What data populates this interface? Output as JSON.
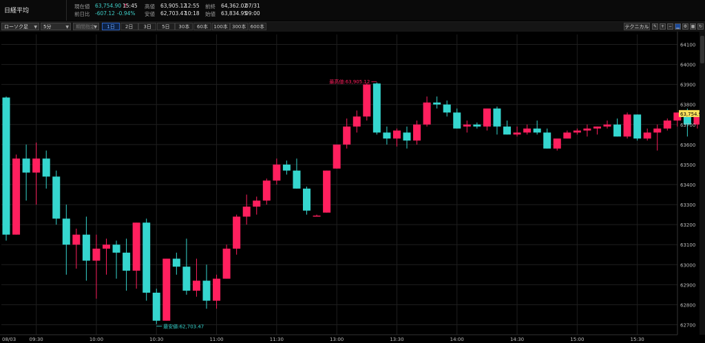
{
  "header": {
    "name": "日経平均",
    "rows": [
      [
        {
          "label": "現在値",
          "value": "63,754.90",
          "cls": "up",
          "extra": "↑",
          "time": "15:45"
        },
        {
          "label": "高値",
          "value": "63,905.12",
          "time": "12:55"
        },
        {
          "label": "前終",
          "value": "64,362.02",
          "time": "07/31"
        }
      ],
      [
        {
          "label": "前日比",
          "value": "-607.12",
          "cls": "up",
          "extra": "-0.94%",
          "time": ""
        },
        {
          "label": "安値",
          "value": "62,703.47",
          "time": "10:18"
        },
        {
          "label": "始値",
          "value": "63,834.95",
          "time": "09:00"
        }
      ]
    ]
  },
  "toolbar": {
    "chart_type": "ローソク足",
    "interval": "5分",
    "period_select": "期間指定",
    "periods": [
      "1日",
      "2日",
      "3日",
      "5日",
      "30本",
      "60本",
      "100本",
      "300本",
      "600本"
    ],
    "active_period": "1日",
    "technical": "テクニカル"
  },
  "colors": {
    "up": "#ff1f5e",
    "down": "#35d6cf",
    "bg": "#000000",
    "grid": "#1f1f1f",
    "price_tag": "#ffe45c"
  },
  "chart_data": {
    "type": "candlestick",
    "date_label": "08/03",
    "x_tick_labels": [
      {
        "i": 3,
        "label": "09:30"
      },
      {
        "i": 9,
        "label": "10:00"
      },
      {
        "i": 15,
        "label": "10:30"
      },
      {
        "i": 21,
        "label": "11:00"
      },
      {
        "i": 27,
        "label": "11:30"
      },
      {
        "i": 33,
        "label": "13:00"
      },
      {
        "i": 39,
        "label": "13:30"
      },
      {
        "i": 45,
        "label": "14:00"
      },
      {
        "i": 51,
        "label": "14:30"
      },
      {
        "i": 57,
        "label": "15:00"
      },
      {
        "i": 63,
        "label": "15:30"
      }
    ],
    "ylim": [
      62650,
      64150
    ],
    "y_ticks": [
      62700,
      62800,
      62900,
      63000,
      63100,
      63200,
      63300,
      63400,
      63500,
      63600,
      63700,
      63800,
      63900,
      64000,
      64100
    ],
    "current_price": 63754.9,
    "current_label": "63,754.90",
    "high_annotation": "最高値:63,905.12",
    "low_annotation": "最安値:62,703.47",
    "candles": [
      [
        63835,
        63840,
        63120,
        63150
      ],
      [
        63150,
        63550,
        63150,
        63530
      ],
      [
        63530,
        63600,
        63320,
        63460
      ],
      [
        63460,
        63610,
        63300,
        63530
      ],
      [
        63530,
        63570,
        63380,
        63440
      ],
      [
        63440,
        63470,
        63200,
        63230
      ],
      [
        63230,
        63300,
        62950,
        63100
      ],
      [
        63100,
        63180,
        62980,
        63150
      ],
      [
        63150,
        63240,
        62920,
        63020
      ],
      [
        63020,
        63150,
        62830,
        63080
      ],
      [
        63080,
        63130,
        62950,
        63100
      ],
      [
        63100,
        63120,
        62930,
        63060
      ],
      [
        63060,
        63130,
        62870,
        62970
      ],
      [
        62970,
        63210,
        62880,
        63210
      ],
      [
        63210,
        63230,
        62820,
        62860
      ],
      [
        62860,
        62880,
        62703,
        62720
      ],
      [
        62720,
        63030,
        62720,
        63030
      ],
      [
        63030,
        63060,
        62950,
        62990
      ],
      [
        62990,
        63130,
        62850,
        62870
      ],
      [
        62870,
        63030,
        62840,
        62920
      ],
      [
        62920,
        63000,
        62780,
        62820
      ],
      [
        62820,
        62950,
        62780,
        62930
      ],
      [
        62930,
        63100,
        62930,
        63080
      ],
      [
        63080,
        63250,
        63050,
        63240
      ],
      [
        63240,
        63350,
        63200,
        63290
      ],
      [
        63290,
        63340,
        63250,
        63320
      ],
      [
        63320,
        63430,
        63300,
        63420
      ],
      [
        63420,
        63530,
        63400,
        63500
      ],
      [
        63500,
        63520,
        63450,
        63470
      ],
      [
        63470,
        63530,
        63380,
        63380
      ],
      [
        63380,
        63390,
        63250,
        63270
      ],
      [
        63240,
        63250,
        63240,
        63245
      ],
      [
        63260,
        63470,
        63260,
        63470
      ],
      [
        63480,
        63600,
        63480,
        63600
      ],
      [
        63600,
        63730,
        63580,
        63690
      ],
      [
        63690,
        63770,
        63660,
        63740
      ],
      [
        63740,
        63905,
        63720,
        63900
      ],
      [
        63905,
        63910,
        63650,
        63660
      ],
      [
        63660,
        63690,
        63600,
        63630
      ],
      [
        63630,
        63680,
        63590,
        63670
      ],
      [
        63660,
        63690,
        63580,
        63620
      ],
      [
        63620,
        63720,
        63600,
        63700
      ],
      [
        63700,
        63840,
        63690,
        63810
      ],
      [
        63810,
        63840,
        63780,
        63800
      ],
      [
        63800,
        63820,
        63740,
        63760
      ],
      [
        63760,
        63780,
        63680,
        63680
      ],
      [
        63690,
        63720,
        63660,
        63700
      ],
      [
        63700,
        63710,
        63680,
        63690
      ],
      [
        63690,
        63780,
        63670,
        63780
      ],
      [
        63780,
        63790,
        63650,
        63690
      ],
      [
        63690,
        63720,
        63650,
        63650
      ],
      [
        63650,
        63690,
        63640,
        63660
      ],
      [
        63660,
        63700,
        63650,
        63680
      ],
      [
        63680,
        63720,
        63650,
        63660
      ],
      [
        63660,
        63680,
        63580,
        63580
      ],
      [
        63580,
        63620,
        63570,
        63630
      ],
      [
        63630,
        63670,
        63630,
        63660
      ],
      [
        63660,
        63680,
        63650,
        63670
      ],
      [
        63670,
        63700,
        63640,
        63680
      ],
      [
        63680,
        63690,
        63650,
        63690
      ],
      [
        63690,
        63720,
        63680,
        63700
      ],
      [
        63700,
        63730,
        63640,
        63640
      ],
      [
        63640,
        63760,
        63630,
        63750
      ],
      [
        63750,
        63750,
        63620,
        63630
      ],
      [
        63630,
        63680,
        63620,
        63660
      ],
      [
        63660,
        63700,
        63570,
        63680
      ],
      [
        63680,
        63730,
        63670,
        63720
      ],
      [
        63720,
        63760,
        63690,
        63760
      ],
      [
        63760,
        63780,
        63640,
        63700
      ],
      [
        63700,
        63770,
        63680,
        63740
      ],
      [
        63740,
        63760,
        63700,
        63720
      ],
      [
        63720,
        63730,
        63710,
        63720
      ],
      [
        63720,
        63760,
        63720,
        63755
      ]
    ]
  }
}
